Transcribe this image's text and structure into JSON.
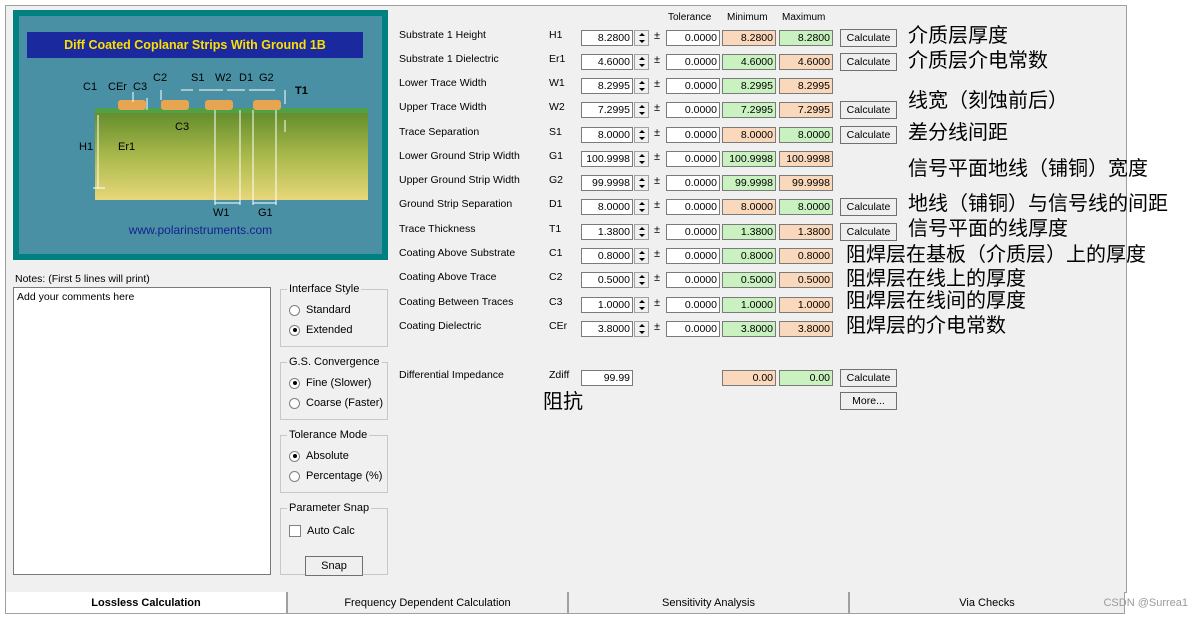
{
  "diagram": {
    "title": "Diff Coated Coplanar Strips With Ground  1B",
    "url": "www.polarinstruments.com",
    "labels": {
      "C1": "C1",
      "CEr": "CEr",
      "C3": "C3",
      "C2": "C2",
      "S1": "S1",
      "W2": "W2",
      "D1": "D1",
      "G2": "G2",
      "T1": "T1",
      "C3b": "C3",
      "H1": "H1",
      "Er1": "Er1",
      "W1": "W1",
      "G1": "G1"
    }
  },
  "notes": {
    "label": "Notes: (First 5 lines will print)",
    "text": "Add your comments here"
  },
  "interface_style": {
    "title": "Interface Style",
    "options": [
      "Standard",
      "Extended"
    ],
    "selected": "Extended"
  },
  "gs_convergence": {
    "title": "G.S. Convergence",
    "options": [
      "Fine (Slower)",
      "Coarse (Faster)"
    ],
    "selected": "Fine (Slower)"
  },
  "tolerance_mode": {
    "title": "Tolerance Mode",
    "options": [
      "Absolute",
      "Percentage (%)"
    ],
    "selected": "Absolute"
  },
  "parameter_snap": {
    "title": "Parameter Snap",
    "auto_calc_label": "Auto Calc",
    "auto_calc_checked": false,
    "snap_label": "Snap"
  },
  "headers": {
    "tolerance": "Tolerance",
    "minimum": "Minimum",
    "maximum": "Maximum"
  },
  "parameters": [
    {
      "label": "Substrate 1 Height",
      "symbol": "H1",
      "value": "8.2800",
      "tol": "0.0000",
      "min": "8.2800",
      "max": "8.2800",
      "min_color": "peach",
      "max_color": "green",
      "calc": "Calculate",
      "annotation": "介质层厚度"
    },
    {
      "label": "Substrate 1 Dielectric",
      "symbol": "Er1",
      "value": "4.6000",
      "tol": "0.0000",
      "min": "4.6000",
      "max": "4.6000",
      "min_color": "green",
      "max_color": "peach",
      "calc": "Calculate",
      "annotation": "介质层介电常数"
    },
    {
      "label": "Lower Trace Width",
      "symbol": "W1",
      "value": "8.2995",
      "tol": "0.0000",
      "min": "8.2995",
      "max": "8.2995",
      "min_color": "green",
      "max_color": "peach",
      "calc": "",
      "annotation": ""
    },
    {
      "label": "Upper Trace Width",
      "symbol": "W2",
      "value": "7.2995",
      "tol": "0.0000",
      "min": "7.2995",
      "max": "7.2995",
      "min_color": "green",
      "max_color": "peach",
      "calc": "Calculate",
      "annotation": "线宽（刻蚀前后）"
    },
    {
      "label": "Trace Separation",
      "symbol": "S1",
      "value": "8.0000",
      "tol": "0.0000",
      "min": "8.0000",
      "max": "8.0000",
      "min_color": "peach",
      "max_color": "green",
      "calc": "Calculate",
      "annotation": "差分线间距"
    },
    {
      "label": "Lower Ground Strip Width",
      "symbol": "G1",
      "value": "100.9998",
      "tol": "0.0000",
      "min": "100.9998",
      "max": "100.9998",
      "min_color": "green",
      "max_color": "peach",
      "calc": "",
      "annotation": "信号平面地线（铺铜）宽度"
    },
    {
      "label": "Upper Ground Strip Width",
      "symbol": "G2",
      "value": "99.9998",
      "tol": "0.0000",
      "min": "99.9998",
      "max": "99.9998",
      "min_color": "green",
      "max_color": "peach",
      "calc": "",
      "annotation": ""
    },
    {
      "label": "Ground Strip Separation",
      "symbol": "D1",
      "value": "8.0000",
      "tol": "0.0000",
      "min": "8.0000",
      "max": "8.0000",
      "min_color": "peach",
      "max_color": "green",
      "calc": "Calculate",
      "annotation": "地线（铺铜）与信号线的间距"
    },
    {
      "label": "Trace Thickness",
      "symbol": "T1",
      "value": "1.3800",
      "tol": "0.0000",
      "min": "1.3800",
      "max": "1.3800",
      "min_color": "green",
      "max_color": "peach",
      "calc": "Calculate",
      "annotation": "信号平面的线厚度"
    },
    {
      "label": "Coating Above Substrate",
      "symbol": "C1",
      "value": "0.8000",
      "tol": "0.0000",
      "min": "0.8000",
      "max": "0.8000",
      "min_color": "green",
      "max_color": "peach",
      "calc": "",
      "annotation": "阻焊层在基板（介质层）上的厚度"
    },
    {
      "label": "Coating Above Trace",
      "symbol": "C2",
      "value": "0.5000",
      "tol": "0.0000",
      "min": "0.5000",
      "max": "0.5000",
      "min_color": "green",
      "max_color": "peach",
      "calc": "",
      "annotation": "阻焊层在线上的厚度"
    },
    {
      "label": "Coating Between Traces",
      "symbol": "C3",
      "value": "1.0000",
      "tol": "0.0000",
      "min": "1.0000",
      "max": "1.0000",
      "min_color": "green",
      "max_color": "peach",
      "calc": "",
      "annotation": "阻焊层在线间的厚度"
    },
    {
      "label": "Coating Dielectric",
      "symbol": "CEr",
      "value": "3.8000",
      "tol": "0.0000",
      "min": "3.8000",
      "max": "3.8000",
      "min_color": "green",
      "max_color": "peach",
      "calc": "",
      "annotation": "阻焊层的介电常数"
    }
  ],
  "impedance": {
    "label": "Differential Impedance",
    "symbol": "Zdiff",
    "value": "99.99",
    "min": "0.00",
    "max": "0.00",
    "calc": "Calculate",
    "more": "More...",
    "annotation": "阻抗"
  },
  "tabs": [
    {
      "label": "Lossless Calculation",
      "active": true
    },
    {
      "label": "Frequency Dependent Calculation",
      "active": false
    },
    {
      "label": "Sensitivity Analysis",
      "active": false
    },
    {
      "label": "Via Checks",
      "active": false
    }
  ],
  "watermark": "CSDN @Surrea1",
  "colors": {
    "green": "#c9f2c0",
    "peach": "#fad8bb",
    "diagram_bg": "#00807f",
    "title_bar": "#1a2a9e",
    "title_text": "#ffdf00"
  }
}
